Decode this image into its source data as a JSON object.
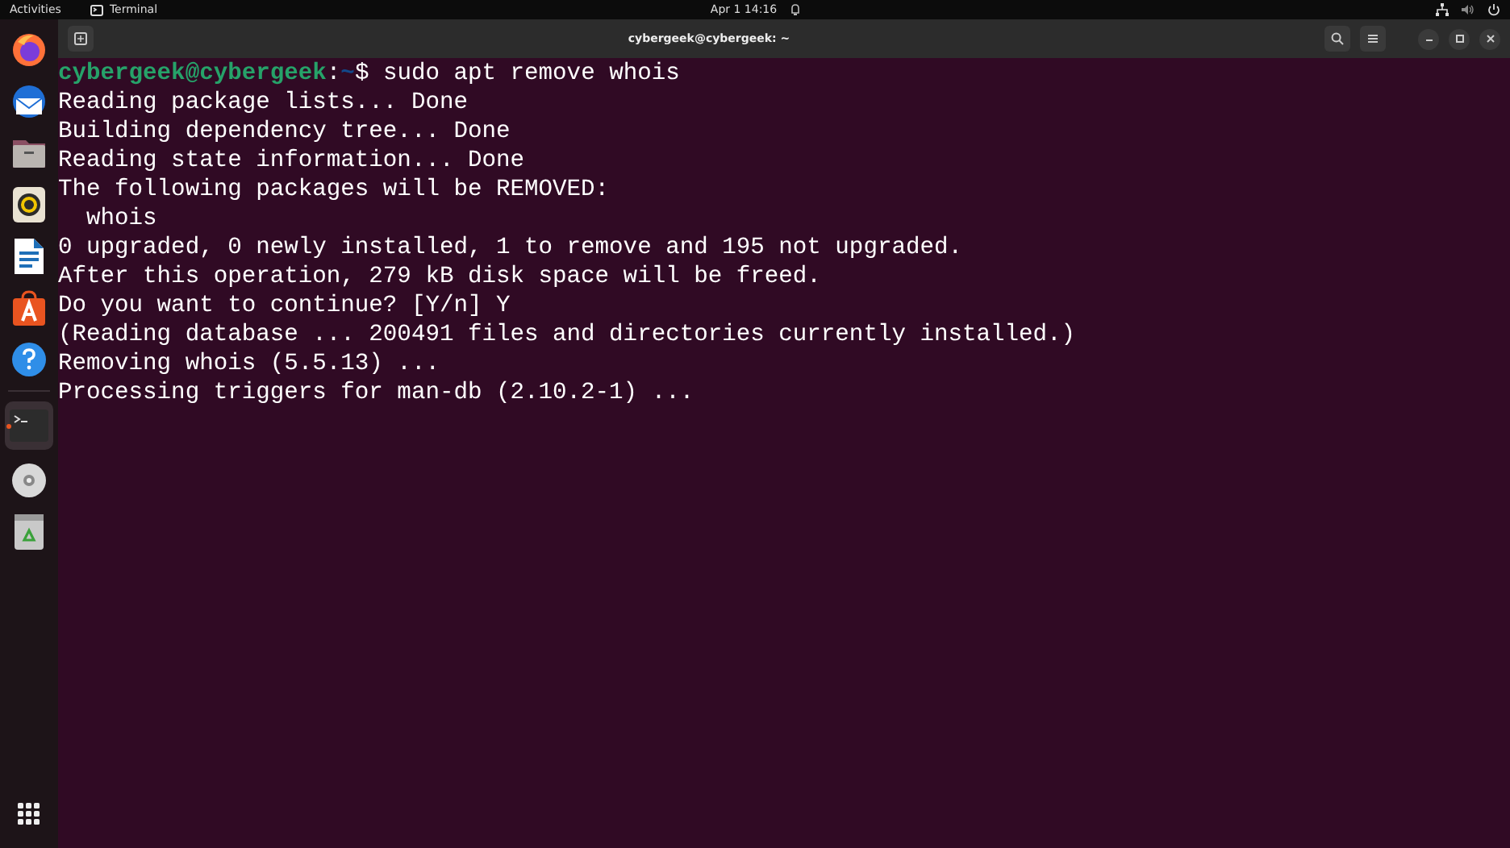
{
  "top_bar": {
    "activities": "Activities",
    "app_name": "Terminal",
    "clock": "Apr 1  14:16"
  },
  "dock": {
    "items": [
      {
        "kind": "firefox",
        "selected": false,
        "running": false
      },
      {
        "kind": "mail",
        "selected": false,
        "running": false
      },
      {
        "kind": "files",
        "selected": false,
        "running": false
      },
      {
        "kind": "music",
        "selected": false,
        "running": false
      },
      {
        "kind": "writer",
        "selected": false,
        "running": false
      },
      {
        "kind": "store",
        "selected": false,
        "running": false
      },
      {
        "kind": "help",
        "selected": false,
        "running": false
      },
      {
        "kind": "separator"
      },
      {
        "kind": "terminal",
        "selected": true,
        "running": true
      },
      {
        "kind": "disc",
        "selected": false,
        "running": false
      },
      {
        "kind": "trash",
        "selected": false,
        "running": false
      }
    ]
  },
  "window": {
    "title": "cybergeek@cybergeek: ~"
  },
  "terminal": {
    "lines": [
      {
        "kind": "prompt",
        "user_host": "cybergeek@cybergeek",
        "separator": ":",
        "path": "~",
        "symbol": "$",
        "command": " sudo apt remove whois"
      },
      {
        "kind": "output",
        "text": "Reading package lists... Done"
      },
      {
        "kind": "output",
        "text": "Building dependency tree... Done"
      },
      {
        "kind": "output",
        "text": "Reading state information... Done"
      },
      {
        "kind": "output",
        "text": "The following packages will be REMOVED:"
      },
      {
        "kind": "output",
        "text": "  whois"
      },
      {
        "kind": "output",
        "text": "0 upgraded, 0 newly installed, 1 to remove and 195 not upgraded."
      },
      {
        "kind": "output",
        "text": "After this operation, 279 kB disk space will be freed."
      },
      {
        "kind": "output",
        "text": "Do you want to continue? [Y/n] Y"
      },
      {
        "kind": "output",
        "text": "(Reading database ... 200491 files and directories currently installed.)"
      },
      {
        "kind": "output",
        "text": "Removing whois (5.5.13) ..."
      },
      {
        "kind": "output",
        "text": "Processing triggers for man-db (2.10.2-1) ..."
      }
    ]
  }
}
